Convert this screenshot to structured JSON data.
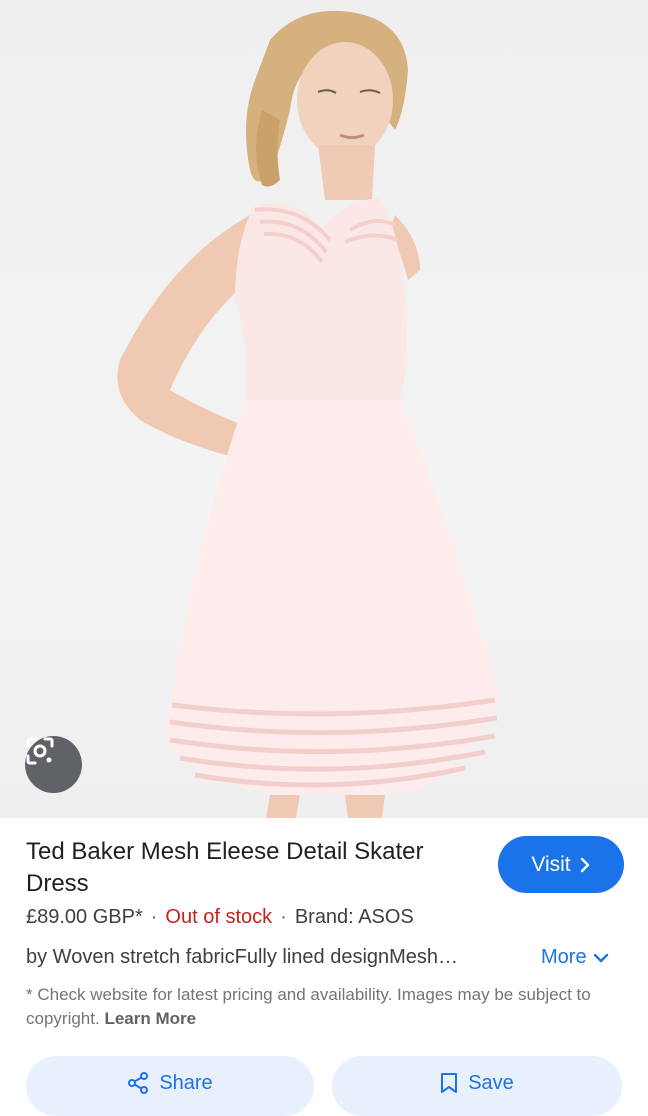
{
  "image": {
    "alt_icon": "dress-photo"
  },
  "lens_button": {
    "icon": "camera-search-icon"
  },
  "product": {
    "title": "Ted Baker Mesh Eleese Detail Skater Dress",
    "price": "£89.00 GBP*",
    "separator": "·",
    "stock_status": "Out of stock",
    "brand": "Brand: ASOS",
    "description": "by Woven stretch fabricFully lined designMesh…",
    "more_label": "More",
    "disclaimer": "* Check website for latest pricing and availability. Images may be subject to copyright.",
    "learn_more": "Learn More"
  },
  "visit_button": {
    "label": "Visit"
  },
  "actions": {
    "share_label": "Share",
    "save_label": "Save"
  },
  "colors": {
    "accent": "#1a73e8",
    "out_of_stock": "#c5221f"
  }
}
